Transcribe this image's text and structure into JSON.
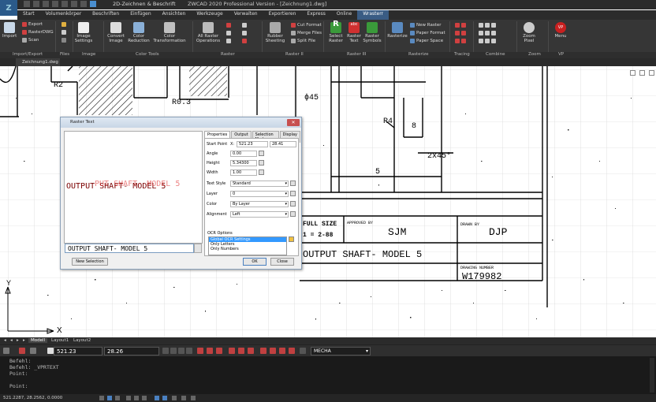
{
  "title_bar": {
    "workspace": "2D-Zeichnen & Beschrift",
    "window_title": "ZWCAD 2020 Professional Version - [Zeichnung1.dwg]"
  },
  "menu": {
    "tabs": [
      "Start",
      "Volumenkörper",
      "Beschriften",
      "Einfügen",
      "Ansichten",
      "Werkzeuge",
      "Verwalten",
      "Exportieren",
      "Express",
      "Online",
      "Wrasterr"
    ],
    "active_tab": "Wrasterr"
  },
  "ribbon": {
    "buttons": {
      "import": "Import",
      "export": "Export",
      "rasterdwg": "RasterDWG",
      "scan": "Scan",
      "image_settings": "Image Settings",
      "convert_image": "Convert Image",
      "color_reduction": "Color Reduction",
      "color_transformation": "Color Transformation",
      "all_raster_operations": "All Raster Operations",
      "rubber_sheeting": "Rubber Sheeting",
      "cut_format": "Cut Format",
      "merge_files": "Merge Files",
      "split_file": "Split File",
      "select_raster": "Select Raster",
      "raster_text": "Raster Text",
      "raster_symbols": "Raster Symbols",
      "rasterize": "Rasterize",
      "new_raster": "New Raster",
      "paper_format": "Paper Format",
      "paper_space": "Paper Space",
      "zoom_pixel": "Zoom Pixel",
      "menu": "Menu"
    },
    "groups": [
      "Import/Export",
      "Files",
      "Image",
      "Color Tools",
      "Raster",
      "Raster II",
      "Raster III",
      "Rasterize",
      "Tracing",
      "Combine",
      "Zoom",
      "VP"
    ]
  },
  "doc_tab": "Zeichnung1.dwg",
  "drawing": {
    "labels": {
      "r2": "R2",
      "r03": "R0.3",
      "phi45": "ϕ45",
      "r4": "R4",
      "eight": "8",
      "chamfer": "2x45°",
      "five": "5",
      "full_size": "FULL SIZE",
      "scale_ratio": "1 = 2-88",
      "approved_by": "APPROVED BY",
      "approver": "SJM",
      "drawn_by": "DRAWN BY",
      "drawer": "DJP",
      "part_title": "OUTPUT SHAFT- MODEL 5",
      "drawing_number_label": "DRAWING NUMBER",
      "drawing_number": "W179982",
      "axis_x": "X",
      "axis_y": "Y"
    }
  },
  "dialog": {
    "title": "Raster Text",
    "close": "✕",
    "preview_text": "OUTPUT SHAFT- MODEL 5",
    "preview_ghost": "PUT SHAFT- MODEL 5",
    "ocr_result": "OUTPUT SHAFT- MODEL 5",
    "tabs": [
      "Properties",
      "Output",
      "Selection Mode",
      "Display"
    ],
    "active_tab": "Properties",
    "props": {
      "start_point_label": "Start Point",
      "start_x_label": "X:",
      "start_x": "521.23",
      "start_y": "28.41",
      "angle_label": "Angle",
      "angle": "0.00",
      "height_label": "Height",
      "height": "5.34300",
      "width_label": "Width",
      "width": "1.00",
      "text_style_label": "Text Style",
      "text_style": "Standard",
      "layer_label": "Layer",
      "layer": "0",
      "color_label": "Color",
      "color": "By Layer",
      "alignment_label": "Alignment",
      "alignment": "Left"
    },
    "ocr_options_label": "OCR Options",
    "ocr_options": [
      "Global OCR Settings",
      "Only Letters",
      "Only Numbers"
    ],
    "ocr_selected": "Global OCR Settings",
    "new_selection": "New Selection",
    "ok": "OK",
    "cancel": "Close"
  },
  "layout_tabs": [
    "Modell",
    "Layout1",
    "Layout2"
  ],
  "active_layout": "Modell",
  "coord_bar": {
    "x": "521.23",
    "y": "28.26",
    "layer": "MECHA"
  },
  "command_history": [
    "Befehl:",
    "Befehl: _VPRTEXT",
    "Point:",
    "",
    "Point:"
  ],
  "status": {
    "coords": "521.2287, 28.2562, 0.0000"
  },
  "colors": {
    "accent": "#3a5c84",
    "preview_text": "#7a0000",
    "close_button": "#c75050"
  }
}
